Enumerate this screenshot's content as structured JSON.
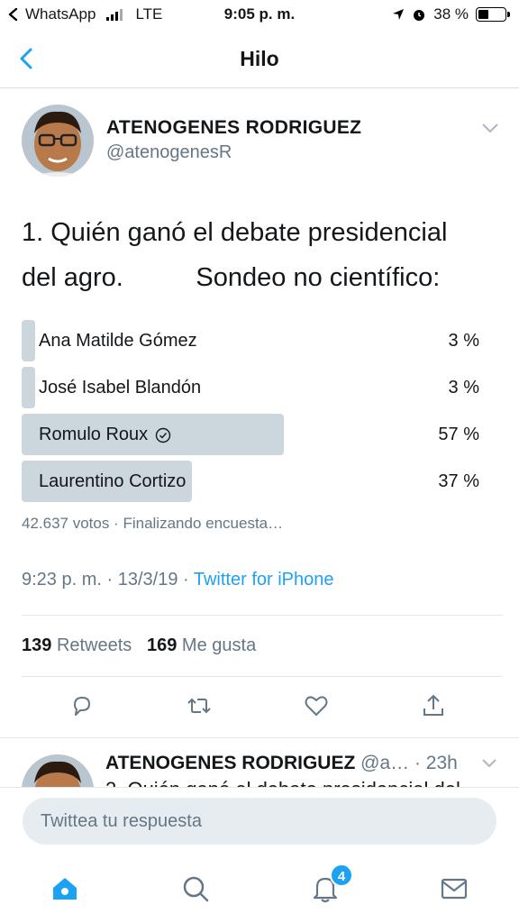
{
  "status_bar": {
    "back_app": "WhatsApp",
    "network": "LTE",
    "time": "9:05 p. m.",
    "battery": "38 %",
    "battery_level": 0.38
  },
  "nav": {
    "title": "Hilo",
    "back_icon": "chevron-left-icon"
  },
  "tweet": {
    "author_name": "ATENOGENES RODRIGUEZ",
    "author_handle": "@atenogenesR",
    "text": "1. Quién ganó el debate presidencial\ndel agro.          Sondeo no científico:",
    "poll": {
      "options": [
        {
          "label": "Ana Matilde Gómez",
          "percent_label": "3 %",
          "percent": 3,
          "winner": false
        },
        {
          "label": "José Isabel Blandón",
          "percent_label": "3 %",
          "percent": 3,
          "winner": false
        },
        {
          "label": "Romulo Roux",
          "percent_label": "57 %",
          "percent": 57,
          "winner": true
        },
        {
          "label": "Laurentino Cortizo",
          "percent_label": "37 %",
          "percent": 37,
          "winner": false
        }
      ],
      "meta": "42.637 votos · Finalizando encuesta…"
    },
    "timestamp": "9:23 p. m. · 13/3/19 · ",
    "source": "Twitter for iPhone",
    "stats": {
      "retweets_count": "139",
      "retweets_label": "Retweets",
      "likes_count": "169",
      "likes_label": "Me gusta"
    }
  },
  "reply_preview": {
    "author_name": "ATENOGENES RODRIGUEZ",
    "handle_time": "@a… · 23h",
    "text": "2. Quién ganó el debate presidencial del"
  },
  "compose": {
    "placeholder": "Twittea tu respuesta"
  },
  "tab_bar": {
    "notifications_badge": "4",
    "accent_color": "#1da1f2"
  }
}
